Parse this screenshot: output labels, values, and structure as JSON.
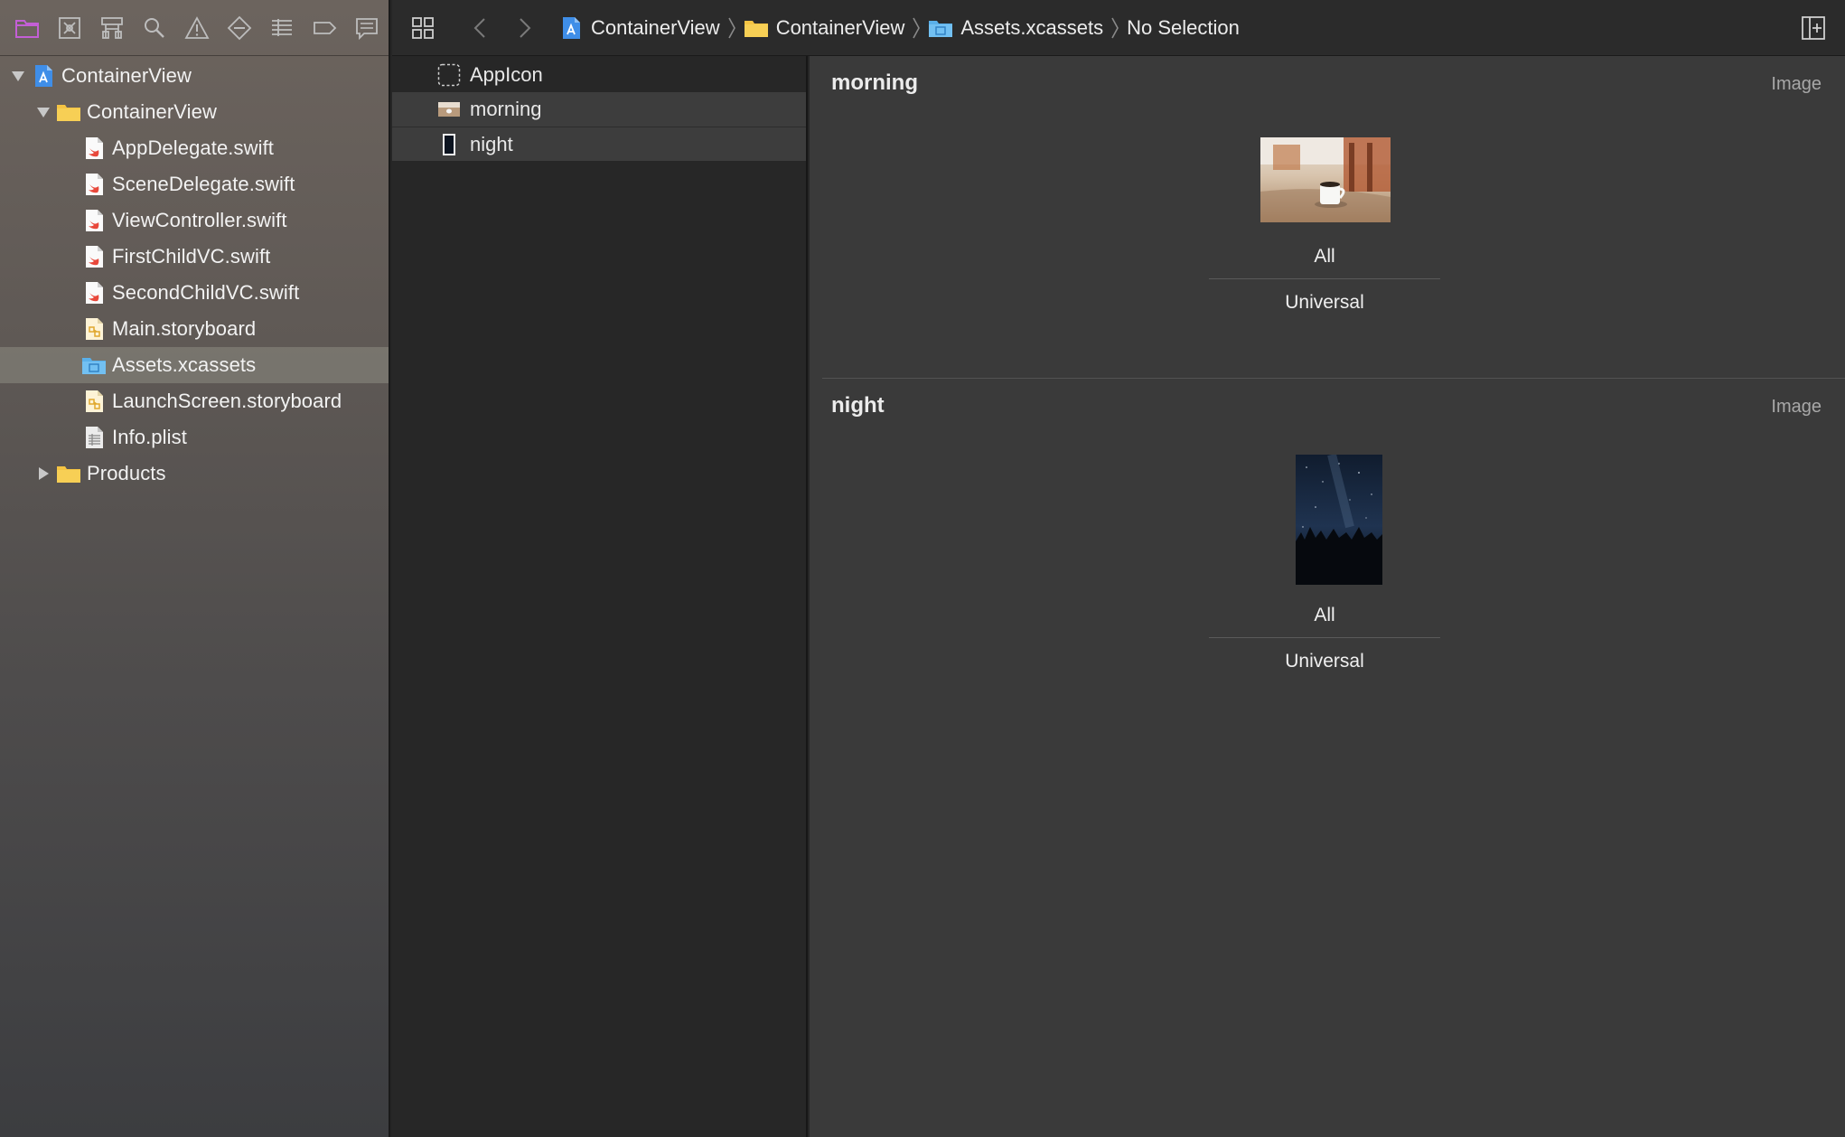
{
  "navigator": {
    "toolbar_icons": [
      "project-navigator-icon",
      "source-control-icon",
      "symbol-navigator-icon",
      "find-navigator-icon",
      "issue-navigator-icon",
      "test-navigator-icon",
      "debug-navigator-icon",
      "breakpoint-navigator-icon",
      "report-navigator-icon"
    ],
    "tree": {
      "project": "ContainerView",
      "group": "ContainerView",
      "files": [
        "AppDelegate.swift",
        "SceneDelegate.swift",
        "ViewController.swift",
        "FirstChildVC.swift",
        "SecondChildVC.swift",
        "Main.storyboard",
        "Assets.xcassets",
        "LaunchScreen.storyboard",
        "Info.plist"
      ],
      "products": "Products",
      "selected": "Assets.xcassets"
    }
  },
  "jumpbar": {
    "crumbs": [
      "ContainerView",
      "ContainerView",
      "Assets.xcassets",
      "No Selection"
    ]
  },
  "asset_list": {
    "items": [
      "AppIcon",
      "morning",
      "night"
    ]
  },
  "detail": {
    "sections": [
      {
        "title": "morning",
        "type": "Image",
        "scale": "All",
        "idiom": "Universal"
      },
      {
        "title": "night",
        "type": "Image",
        "scale": "All",
        "idiom": "Universal"
      }
    ]
  },
  "colors": {
    "swift_red": "#e8483b",
    "folder_yellow": "#f5c443",
    "assets_blue": "#5ab0ea",
    "project_blue": "#3f8ee8",
    "nav_active_purple": "#c35fd6"
  }
}
